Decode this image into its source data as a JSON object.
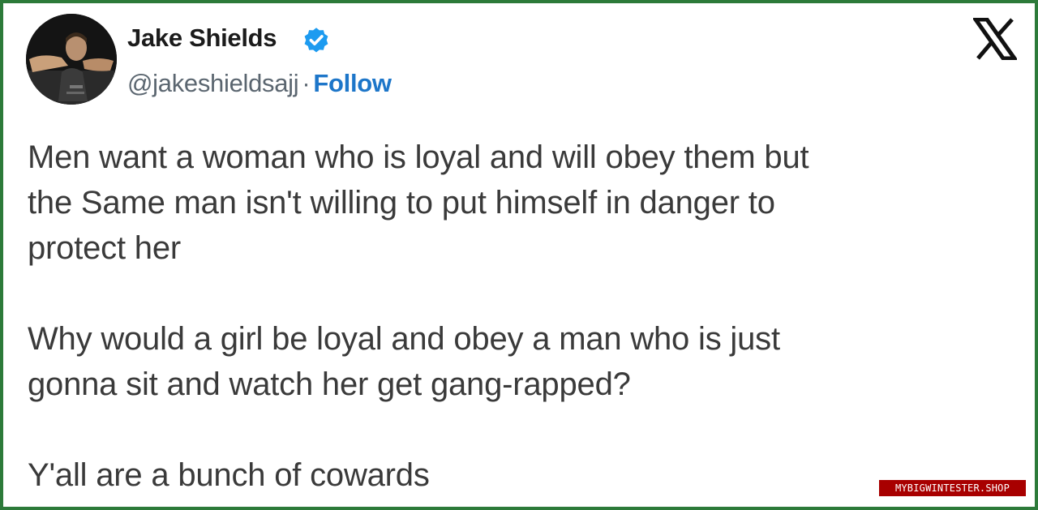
{
  "tweet": {
    "author": {
      "name": "Jake Shields",
      "handle": "@jakeshieldsajj",
      "separator": "·",
      "follow_label": "Follow",
      "verified_icon": "verified-badge-icon",
      "avatar_icon": "profile-photo"
    },
    "platform_icon": "x-logo-icon",
    "paragraphs": [
      [
        "Men want a woman who is loyal and will obey them but",
        "the Same man isn't willing to put himself in danger to",
        "protect her"
      ],
      [
        "Why would a girl be loyal and obey a man who is just",
        "gonna sit and watch her get gang-rapped?"
      ],
      [
        "Y'all are a bunch of cowards"
      ]
    ]
  },
  "watermark": {
    "text": "MYBIGWINTESTER.SHOP"
  },
  "colors": {
    "border": "#2d7a3a",
    "follow": "#1d76c9",
    "verified": "#1d9bf0",
    "text": "#3a3a3a",
    "handle": "#5b6670",
    "watermark_bg": "#a80000"
  }
}
